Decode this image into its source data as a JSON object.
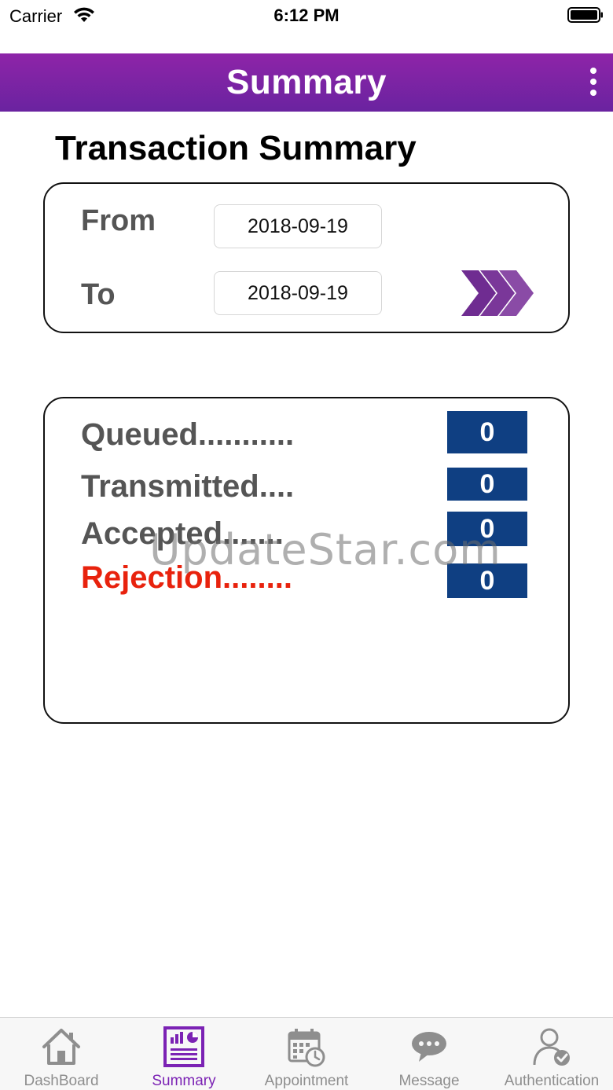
{
  "status_bar": {
    "carrier": "Carrier",
    "time": "6:12 PM"
  },
  "header": {
    "title": "Summary"
  },
  "page": {
    "title": "Transaction Summary"
  },
  "date_filter": {
    "from_label": "From",
    "from_value": "2018-09-19",
    "to_label": "To",
    "to_value": "2018-09-19"
  },
  "stats": {
    "queued_label": "Queued...........",
    "queued_value": "0",
    "transmitted_label": "Transmitted....",
    "transmitted_value": "0",
    "accepted_label": "Accepted.......",
    "accepted_value": "0",
    "rejection_label": "Rejection........",
    "rejection_value": "0"
  },
  "watermark": "UpdateStar.com",
  "tabs": {
    "dashboard": "DashBoard",
    "summary": "Summary",
    "appointment": "Appointment",
    "message": "Message",
    "authentication": "Authentication",
    "active": "summary"
  },
  "colors": {
    "header_gradient_start": "#8e24a8",
    "header_gradient_end": "#6a23a0",
    "accent_purple": "#7b22b4",
    "stat_box": "#0f3f82",
    "rejection_red": "#e8220d",
    "inactive_tab": "#8e8e8e"
  }
}
